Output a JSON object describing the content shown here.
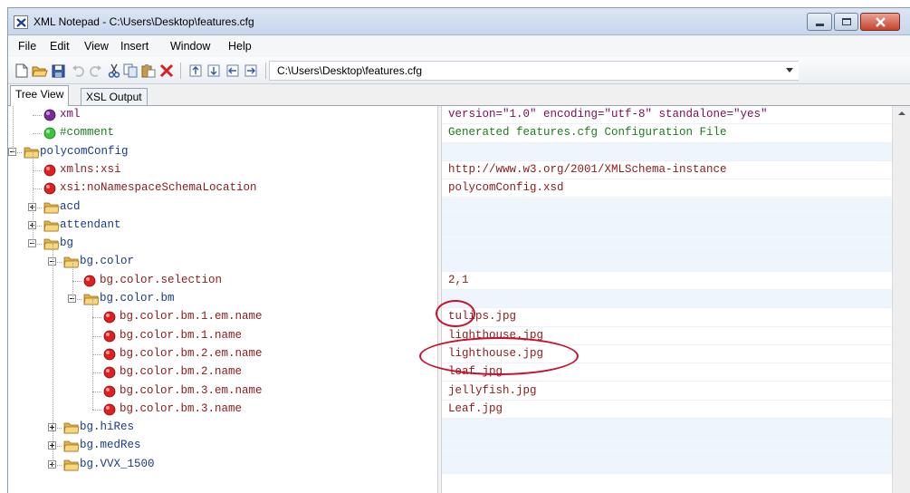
{
  "window": {
    "title": "XML Notepad - C:\\Users\\Desktop\\features.cfg"
  },
  "menu": [
    "File",
    "Edit",
    "View",
    "Insert",
    "Window",
    "Help"
  ],
  "toolbar": {
    "path": "C:\\Users\\Desktop\\features.cfg",
    "icons": [
      "new-icon",
      "open-icon",
      "save-icon",
      "undo-icon",
      "redo-icon",
      "cut-icon",
      "copy-icon",
      "paste-icon",
      "delete-icon",
      "nudge-up-icon",
      "nudge-down-icon",
      "nudge-left-icon",
      "nudge-right-icon"
    ]
  },
  "tabs": [
    {
      "label": "Tree View",
      "active": true
    },
    {
      "label": "XSL Output",
      "active": false
    }
  ],
  "tree": [
    {
      "label": "xml",
      "kind": "decl",
      "value": "version=\"1.0\" encoding=\"utf-8\" standalone=\"yes\""
    },
    {
      "label": "#comment",
      "kind": "comment",
      "value": "Generated features.cfg Configuration File"
    },
    {
      "label": "polycomConfig",
      "kind": "element",
      "value": ""
    },
    {
      "label": "xmlns:xsi",
      "kind": "attr",
      "value": "http://www.w3.org/2001/XMLSchema-instance"
    },
    {
      "label": "xsi:noNamespaceSchemaLocation",
      "kind": "attr",
      "value": "polycomConfig.xsd"
    },
    {
      "label": "acd",
      "kind": "element",
      "value": ""
    },
    {
      "label": "attendant",
      "kind": "element",
      "value": ""
    },
    {
      "label": "bg",
      "kind": "element",
      "value": ""
    },
    {
      "label": "bg.color",
      "kind": "element",
      "value": ""
    },
    {
      "label": "bg.color.selection",
      "kind": "attr",
      "value": "2,1"
    },
    {
      "label": "bg.color.bm",
      "kind": "element",
      "value": ""
    },
    {
      "label": "bg.color.bm.1.em.name",
      "kind": "attr",
      "value": "tulips.jpg"
    },
    {
      "label": "bg.color.bm.1.name",
      "kind": "attr",
      "value": "lighthouse.jpg"
    },
    {
      "label": "bg.color.bm.2.em.name",
      "kind": "attr",
      "value": "lighthouse.jpg"
    },
    {
      "label": "bg.color.bm.2.name",
      "kind": "attr",
      "value": "leaf.jpg"
    },
    {
      "label": "bg.color.bm.3.em.name",
      "kind": "attr",
      "value": "jellyfish.jpg"
    },
    {
      "label": "bg.color.bm.3.name",
      "kind": "attr",
      "value": "Leaf.jpg"
    },
    {
      "label": "bg.hiRes",
      "kind": "element",
      "value": ""
    },
    {
      "label": "bg.medRes",
      "kind": "element",
      "value": ""
    },
    {
      "label": "bg.VVX_1500",
      "kind": "element",
      "value": ""
    }
  ],
  "colors": {
    "annotation": "#c8102e",
    "attribute": "#8b1a1a",
    "element": "#1a3a8a",
    "comment": "#1f7a1f"
  }
}
